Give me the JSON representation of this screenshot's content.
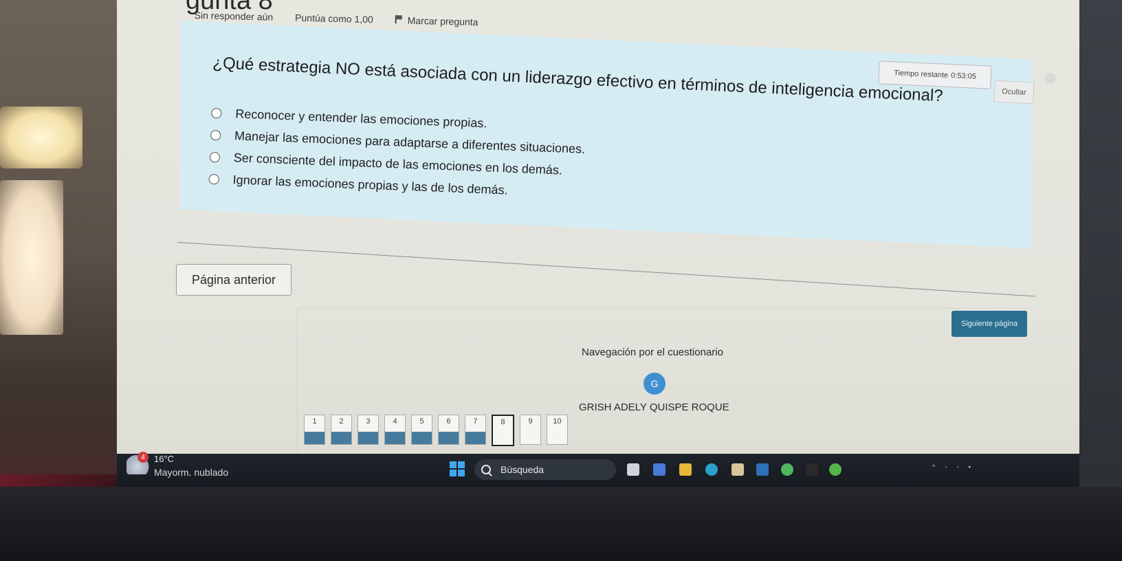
{
  "header": {
    "title_fragment": "gunta 8",
    "status": "Sin responder aún",
    "score": "Puntúa como 1,00",
    "flag_label": "Marcar pregunta"
  },
  "timer": {
    "label": "Tiempo restante",
    "value": "0:53:05",
    "hide_label": "Ocultar"
  },
  "question": {
    "text": "¿Qué estrategia NO está asociada con un liderazgo efectivo en términos de inteligencia emocional?",
    "options": [
      "Reconocer y entender las emociones propias.",
      "Manejar las emociones para adaptarse a diferentes situaciones.",
      "Ser consciente del impacto de las emociones en los demás.",
      "Ignorar las emociones propias y las de los demás."
    ]
  },
  "buttons": {
    "prev": "Página anterior",
    "next": "Siguiente página"
  },
  "quiz_nav": {
    "title": "Navegación por el cuestionario",
    "avatar_initial": "G",
    "user_name": "GRISH ADELY QUISPE ROQUE",
    "questions": [
      {
        "n": "1",
        "answered": true
      },
      {
        "n": "2",
        "answered": true
      },
      {
        "n": "3",
        "answered": true
      },
      {
        "n": "4",
        "answered": true
      },
      {
        "n": "5",
        "answered": true
      },
      {
        "n": "6",
        "answered": true
      },
      {
        "n": "7",
        "answered": true
      },
      {
        "n": "8",
        "answered": false,
        "current": true
      },
      {
        "n": "9",
        "answered": false
      },
      {
        "n": "10",
        "answered": false
      }
    ]
  },
  "taskbar": {
    "weather_badge": "4",
    "weather_temp": "16°C",
    "weather_desc": "Mayorm. nublado",
    "search_label": "Búsqueda"
  },
  "colors": {
    "question_bg": "#d6ecf3",
    "answered_fill": "#467b9d",
    "next_button": "#2b6f8f",
    "taskbar": "#1b1f26"
  }
}
